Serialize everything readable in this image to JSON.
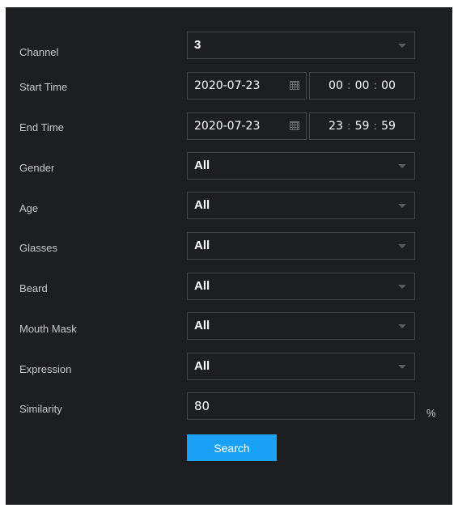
{
  "form": {
    "channel": {
      "label": "Channel",
      "value": "3"
    },
    "start_time": {
      "label": "Start Time",
      "date": "2020-07-23",
      "hh": "00",
      "mm": "00",
      "ss": "00"
    },
    "end_time": {
      "label": "End Time",
      "date": "2020-07-23",
      "hh": "23",
      "mm": "59",
      "ss": "59"
    },
    "gender": {
      "label": "Gender",
      "value": "All"
    },
    "age": {
      "label": "Age",
      "value": "All"
    },
    "glasses": {
      "label": "Glasses",
      "value": "All"
    },
    "beard": {
      "label": "Beard",
      "value": "All"
    },
    "mouth_mask": {
      "label": "Mouth Mask",
      "value": "All"
    },
    "expression": {
      "label": "Expression",
      "value": "All"
    },
    "similarity": {
      "label": "Similarity",
      "value": "80",
      "unit": "%"
    },
    "time_separator": ":",
    "search_label": "Search"
  },
  "colors": {
    "background": "#1d1e22",
    "border": "#44464c",
    "accent": "#1aa1f6"
  }
}
